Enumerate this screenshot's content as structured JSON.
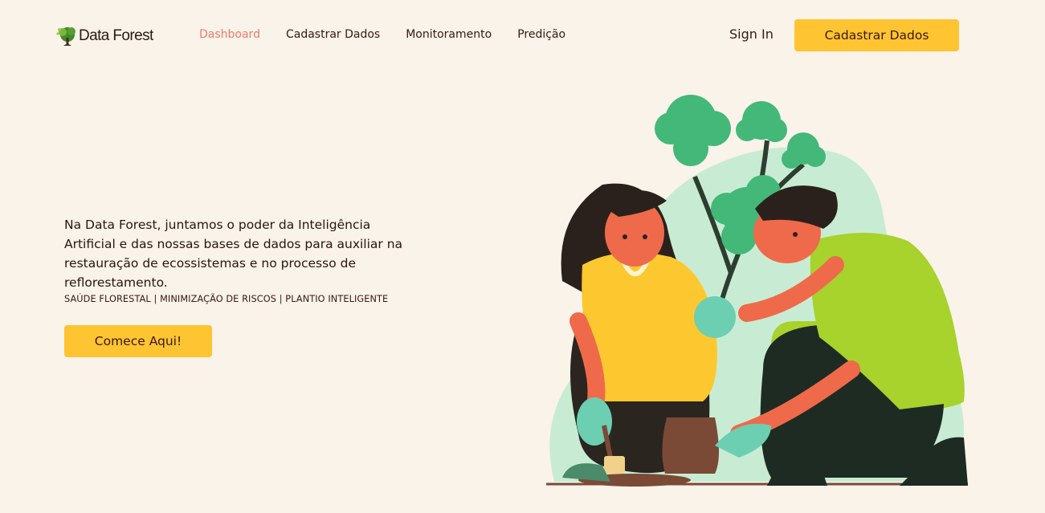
{
  "logo": {
    "text": "Data Forest",
    "icon": "tree-logo-icon"
  },
  "nav": {
    "links": [
      {
        "label": "Dashboard",
        "active": true
      },
      {
        "label": "Cadastrar Dados",
        "active": false
      },
      {
        "label": "Monitoramento",
        "active": false
      },
      {
        "label": "Predição",
        "active": false
      }
    ],
    "sign_in": "Sign In",
    "cta": "Cadastrar Dados"
  },
  "hero": {
    "description": "Na Data Forest, juntamos o poder da Inteligência Artificial e das nossas bases de dados para auxiliar na restauração de ecossistemas e no processo de reflorestamento.",
    "tags": "SAÚDE FLORESTAL | MINIMIZAÇÃO DE RISCOS | PLANTIO INTELIGENTE",
    "cta": "Comece Aqui!"
  },
  "colors": {
    "background": "#f9f3ea",
    "accent": "#fec431",
    "active_link": "#ec7a6a",
    "text": "#3a1812"
  }
}
